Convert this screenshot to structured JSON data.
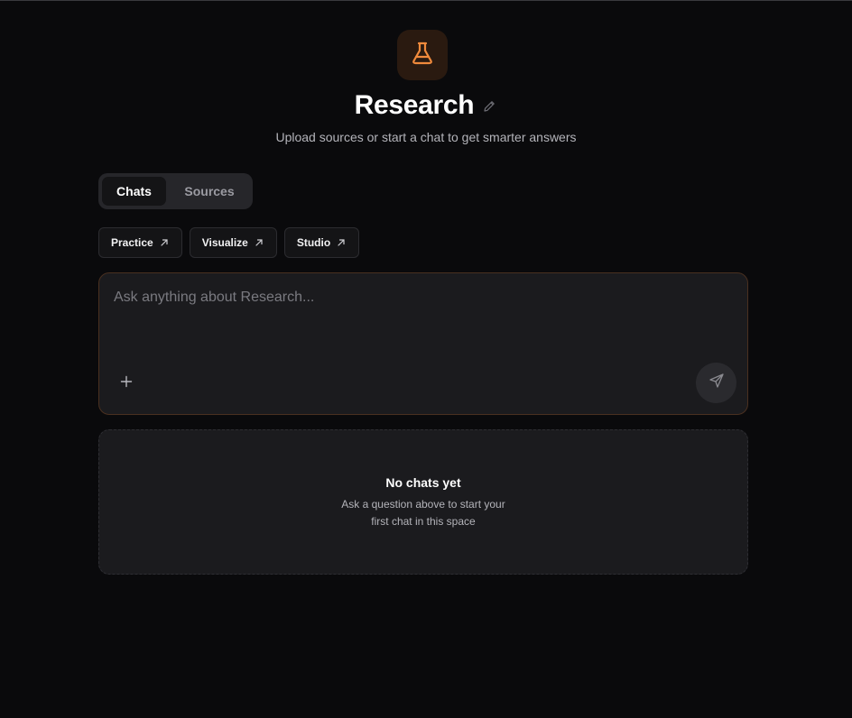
{
  "space": {
    "icon": "flask-icon",
    "title": "Research",
    "subtitle": "Upload sources or start a chat to get smarter answers"
  },
  "tabs": [
    {
      "label": "Chats",
      "active": true
    },
    {
      "label": "Sources",
      "active": false
    }
  ],
  "actions": [
    {
      "label": "Practice",
      "icon": "arrow-up-right-icon"
    },
    {
      "label": "Visualize",
      "icon": "arrow-up-right-icon"
    },
    {
      "label": "Studio",
      "icon": "arrow-up-right-icon"
    }
  ],
  "composer": {
    "placeholder": "Ask anything about Research...",
    "value": "",
    "attach_icon": "plus-icon",
    "send_icon": "send-icon"
  },
  "empty_state": {
    "title": "No chats yet",
    "line1": "Ask a question above to start your",
    "line2": "first chat in this space"
  },
  "colors": {
    "background": "#0a0a0c",
    "accent": "#f08a3c",
    "panel": "#1b1b1e"
  }
}
